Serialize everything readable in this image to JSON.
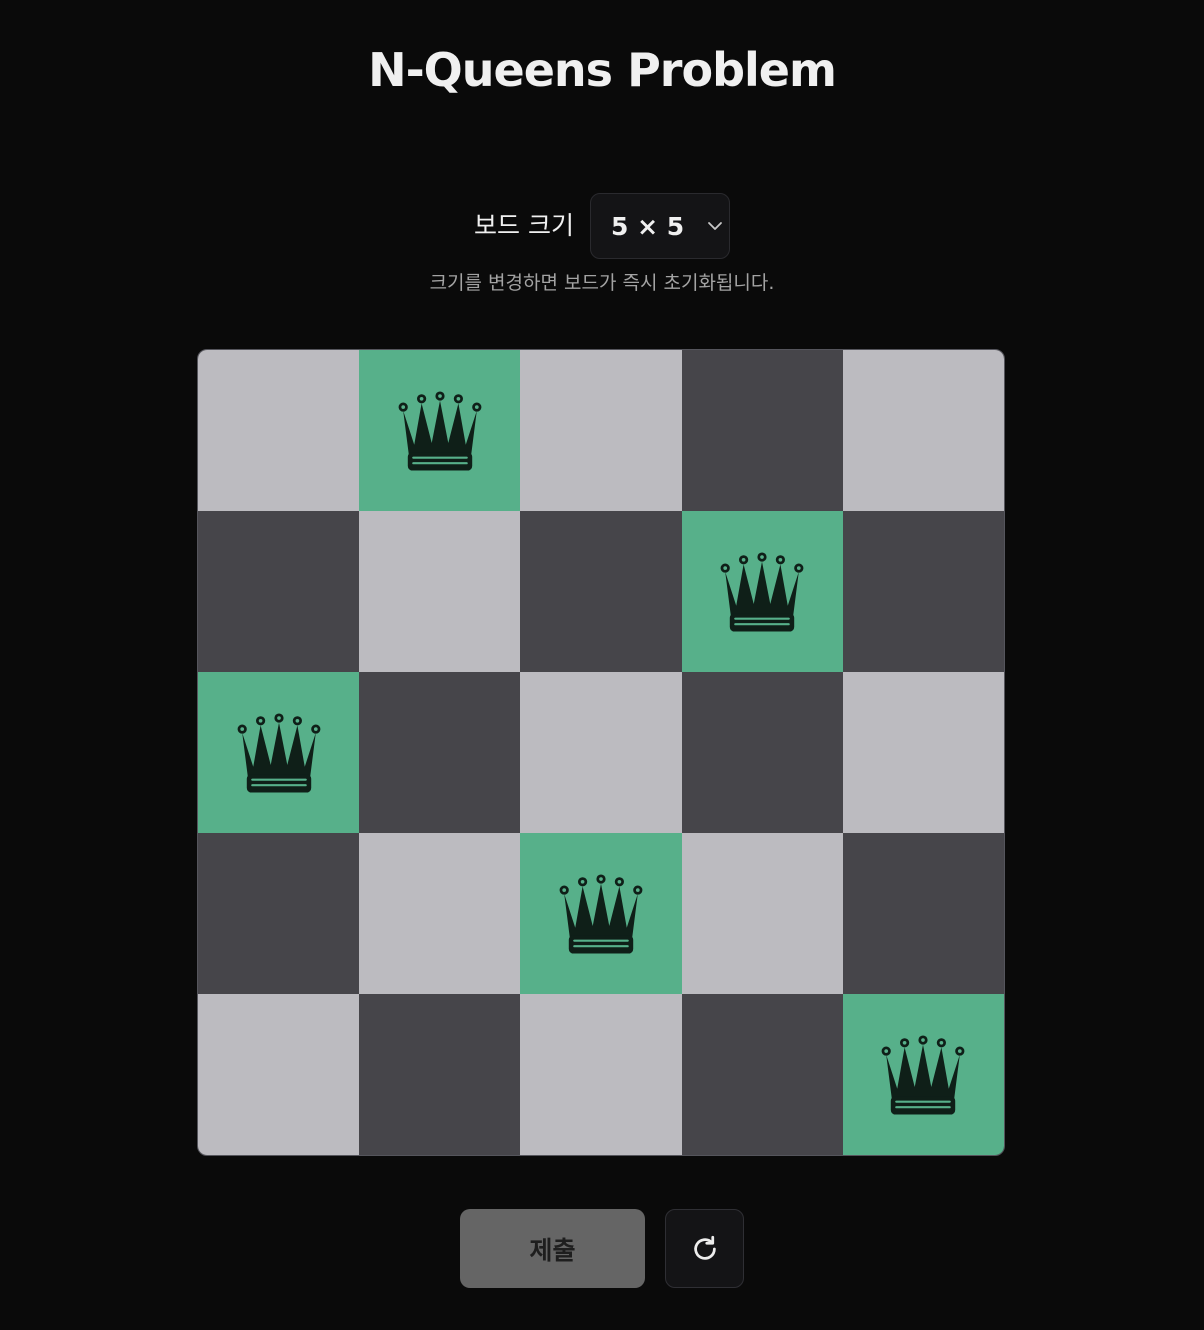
{
  "title": "N-Queens Problem",
  "board_size": {
    "label": "보드 크기",
    "selected": "5 × 5",
    "hint": "크기를 변경하면 보드가 즉시 초기화됩니다."
  },
  "board": {
    "n": 5,
    "queens": [
      [
        0,
        1
      ],
      [
        1,
        3
      ],
      [
        2,
        0
      ],
      [
        3,
        2
      ],
      [
        4,
        4
      ]
    ]
  },
  "actions": {
    "submit_label": "제출",
    "reset_icon": "reset-icon"
  },
  "colors": {
    "background": "#0a0a0a",
    "light_square": "#bcbbc0",
    "dark_square": "#46454a",
    "queen_square": "#57b08a",
    "queen_piece": "#0f1f18",
    "submit_bg": "#656565"
  }
}
